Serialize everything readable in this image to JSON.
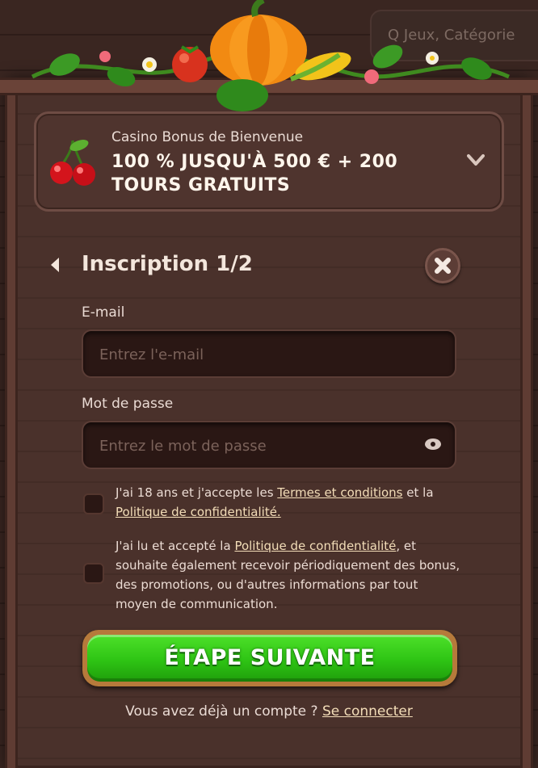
{
  "background": {
    "search_placeholder": "Q  Jeux, Catégorie"
  },
  "bonus": {
    "subtitle": "Casino Bonus de Bienvenue",
    "title": "100 % JUSQU'À 500 € + 200 TOURS GRATUITS",
    "icon": "cherry-icon"
  },
  "form": {
    "title": "Inscription 1/2",
    "email_label": "E-mail",
    "email_placeholder": "Entrez l'e-mail",
    "password_label": "Mot de passe",
    "password_placeholder": "Entrez le mot de passe",
    "consent1": {
      "prefix": "J'ai 18 ans et j'accepte les ",
      "link1": "Termes et conditions",
      "middle": " et la ",
      "link2": "Politique de confidentialité."
    },
    "consent2": {
      "prefix": "J'ai lu et accepté la ",
      "link": "Politique de confidentialité",
      "suffix": ", et souhaite également recevoir périodiquement des bonus, des promotions, ou d'autres informations par tout moyen de communication."
    },
    "next_button": "ÉTAPE SUIVANTE",
    "login_prompt": "Vous avez déjà un compte ? ",
    "login_link": "Se connecter"
  },
  "colors": {
    "accent_green": "#2ec414",
    "panel_wood": "#4a312b",
    "link_color": "#f3ddb8"
  }
}
